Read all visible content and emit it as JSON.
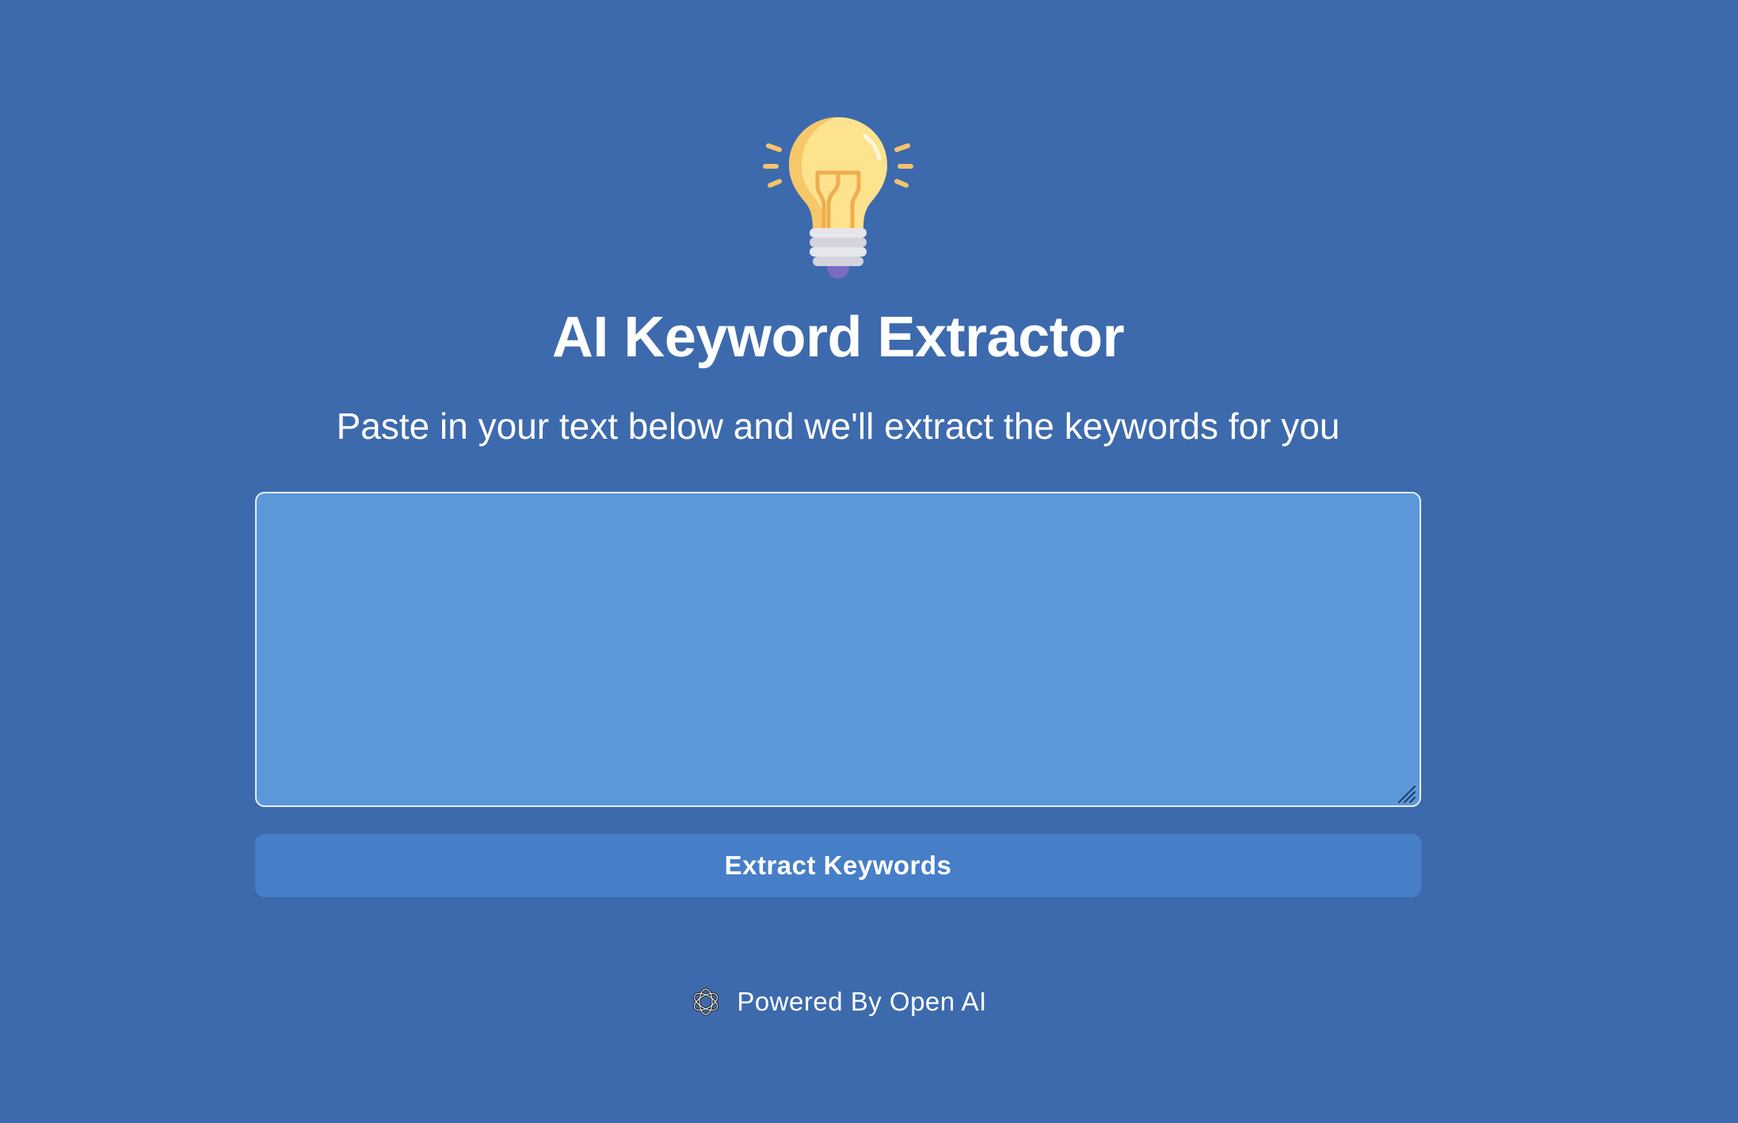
{
  "header": {
    "logo_icon": "lightbulb-icon",
    "title": "AI Keyword Extractor",
    "subtitle": "Paste in your text below and we'll extract the keywords for you"
  },
  "form": {
    "text_input_value": "",
    "text_input_placeholder": "",
    "submit_label": "Extract Keywords"
  },
  "footer": {
    "icon": "openai-logo-icon",
    "text": "Powered By Open AI"
  },
  "colors": {
    "background": "#3d6aad",
    "textarea_bg": "#5b98da",
    "button_bg": "#467ec8",
    "text": "#ffffff",
    "bulb_glass": "#fde38e",
    "bulb_rays": "#f6c36a"
  }
}
